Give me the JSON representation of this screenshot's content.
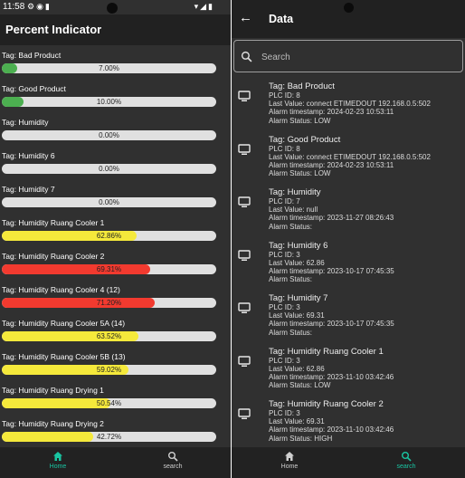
{
  "left": {
    "status_time": "11:58",
    "title": "Percent Indicator",
    "items": [
      {
        "label": "Tag: Bad Product",
        "percent_text": "7.00%",
        "percent": 7.0,
        "color": "#4caf50"
      },
      {
        "label": "Tag: Good Product",
        "percent_text": "10.00%",
        "percent": 10.0,
        "color": "#4caf50"
      },
      {
        "label": "Tag: Humidity",
        "percent_text": "0.00%",
        "percent": 0.0,
        "color": "#4caf50"
      },
      {
        "label": "Tag: Humidity 6",
        "percent_text": "0.00%",
        "percent": 0.0,
        "color": "#4caf50"
      },
      {
        "label": "Tag: Humidity 7",
        "percent_text": "0.00%",
        "percent": 0.0,
        "color": "#4caf50"
      },
      {
        "label": "Tag: Humidity Ruang Cooler 1",
        "percent_text": "62.86%",
        "percent": 62.86,
        "color": "#f5e93b"
      },
      {
        "label": "Tag: Humidity Ruang Cooler 2",
        "percent_text": "69.31%",
        "percent": 69.31,
        "color": "#f23a2f"
      },
      {
        "label": "Tag: Humidity Ruang Cooler 4 (12)",
        "percent_text": "71.20%",
        "percent": 71.2,
        "color": "#f23a2f"
      },
      {
        "label": "Tag: Humidity Ruang Cooler 5A (14)",
        "percent_text": "63.52%",
        "percent": 63.52,
        "color": "#f5e93b"
      },
      {
        "label": "Tag: Humidity Ruang Cooler 5B (13)",
        "percent_text": "59.02%",
        "percent": 59.02,
        "color": "#f5e93b"
      },
      {
        "label": "Tag: Humidity Ruang Drying 1",
        "percent_text": "50.54%",
        "percent": 50.54,
        "color": "#f5e93b"
      },
      {
        "label": "Tag: Humidity Ruang Drying 2",
        "percent_text": "42.72%",
        "percent": 42.72,
        "color": "#f5e93b"
      }
    ],
    "nav": [
      {
        "label": "Home",
        "active": true
      },
      {
        "label": "search",
        "active": false
      }
    ]
  },
  "right": {
    "title": "Data",
    "search_placeholder": "Search",
    "items": [
      {
        "tag": "Tag: Bad Product",
        "plc": "PLC ID: 8",
        "last_value": "Last Value: connect ETIMEDOUT 192.168.0.5:502",
        "timestamp": "Alarm timestamp: 2024-02-23 10:53:11",
        "status": "Alarm Status: LOW"
      },
      {
        "tag": "Tag: Good Product",
        "plc": "PLC ID: 8",
        "last_value": "Last Value: connect ETIMEDOUT 192.168.0.5:502",
        "timestamp": "Alarm timestamp: 2024-02-23 10:53:11",
        "status": "Alarm Status: LOW"
      },
      {
        "tag": "Tag: Humidity",
        "plc": "PLC ID: 7",
        "last_value": "Last Value: null",
        "timestamp": "Alarm timestamp: 2023-11-27 08:26:43",
        "status": "Alarm Status:"
      },
      {
        "tag": "Tag: Humidity 6",
        "plc": "PLC ID: 3",
        "last_value": "Last Value: 62.86",
        "timestamp": "Alarm timestamp: 2023-10-17 07:45:35",
        "status": "Alarm Status:"
      },
      {
        "tag": "Tag: Humidity 7",
        "plc": "PLC ID: 3",
        "last_value": "Last Value: 69.31",
        "timestamp": "Alarm timestamp: 2023-10-17 07:45:35",
        "status": "Alarm Status:"
      },
      {
        "tag": "Tag: Humidity Ruang Cooler 1",
        "plc": "PLC ID: 3",
        "last_value": "Last Value: 62.86",
        "timestamp": "Alarm timestamp: 2023-11-10 03:42:46",
        "status": "Alarm Status: LOW"
      },
      {
        "tag": "Tag: Humidity Ruang Cooler 2",
        "plc": "PLC ID: 3",
        "last_value": "Last Value: 69.31",
        "timestamp": "Alarm timestamp: 2023-11-10 03:42:46",
        "status": "Alarm Status: HIGH"
      }
    ],
    "nav": [
      {
        "label": "Home",
        "active": false
      },
      {
        "label": "search",
        "active": true
      }
    ]
  },
  "colors": {
    "accent": "#19c5a2",
    "background": "#303030",
    "appbar": "#212121"
  }
}
